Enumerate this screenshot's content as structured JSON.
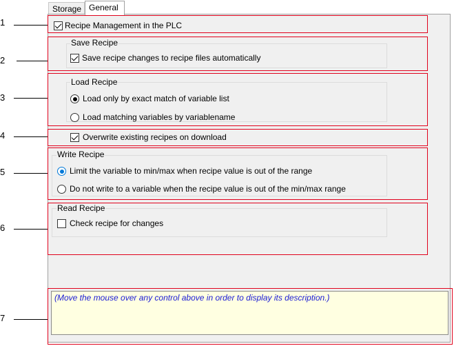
{
  "tabs": [
    {
      "label": "Storage",
      "active": false
    },
    {
      "label": "General",
      "active": true
    }
  ],
  "callouts": [
    "1",
    "2",
    "3",
    "4",
    "5",
    "6",
    "7"
  ],
  "plc": {
    "label": "Recipe Management in the PLC",
    "checked": true
  },
  "save_recipe": {
    "title": "Save Recipe",
    "auto_save": {
      "label": "Save recipe changes to recipe files automatically",
      "checked": true
    }
  },
  "load_recipe": {
    "title": "Load Recipe",
    "options": [
      {
        "label": "Load only by exact match of variable list",
        "selected": true
      },
      {
        "label": "Load matching variables by variablename",
        "selected": false
      }
    ]
  },
  "overwrite": {
    "label": "Overwrite existing recipes on download",
    "checked": true
  },
  "write_recipe": {
    "title": "Write Recipe",
    "options": [
      {
        "label": "Limit the variable to min/max when recipe value is out of the range",
        "selected": true
      },
      {
        "label": "Do not write to a variable when the recipe value is out of the min/max range",
        "selected": false
      }
    ]
  },
  "read_recipe": {
    "title": "Read Recipe",
    "check": {
      "label": "Check recipe for changes",
      "checked": false
    }
  },
  "description": "(Move the mouse over any control above in order to display its description.)",
  "colors": {
    "highlight": "#e0001b",
    "description_text": "#1a1ad4",
    "description_bg": "#ffffe1",
    "radio_accent": "#0078d7"
  }
}
